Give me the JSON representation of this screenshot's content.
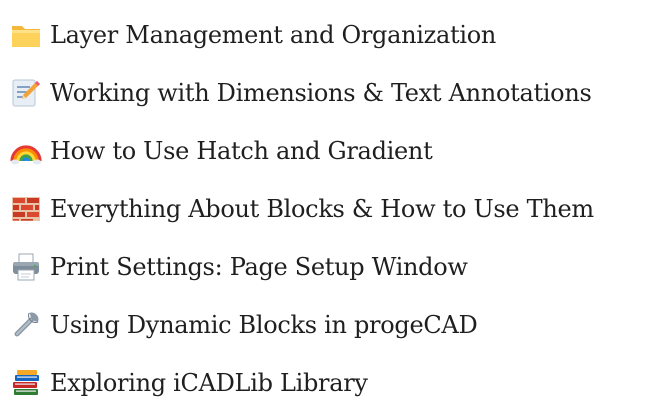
{
  "topics": [
    {
      "icon": "folder-icon",
      "label": "Layer Management and Organization"
    },
    {
      "icon": "memo-pencil-icon",
      "label": "Working with Dimensions & Text Annotations"
    },
    {
      "icon": "rainbow-icon",
      "label": "How to Use Hatch and Gradient"
    },
    {
      "icon": "brick-icon",
      "label": "Everything About Blocks & How to Use Them"
    },
    {
      "icon": "printer-icon",
      "label": "Print Settings: Page Setup Window"
    },
    {
      "icon": "wrench-icon",
      "label": "Using Dynamic Blocks in progeCAD"
    },
    {
      "icon": "books-icon",
      "label": "Exploring iCADLib Library"
    }
  ]
}
